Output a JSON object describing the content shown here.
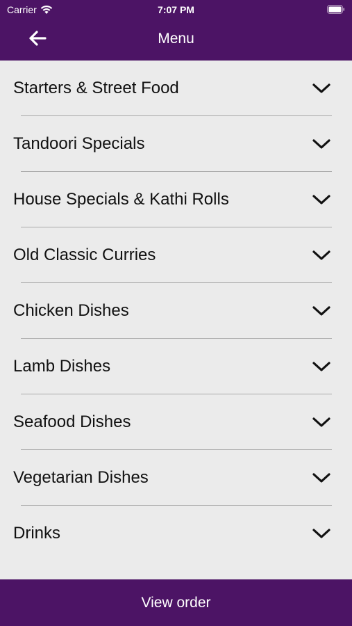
{
  "colors": {
    "brand": "#4c1465",
    "background": "#ebebeb",
    "text": "#111111",
    "divider": "#a9a9a9"
  },
  "status_bar": {
    "carrier": "Carrier",
    "time": "7:07 PM",
    "icons": [
      "wifi-icon",
      "battery-icon"
    ]
  },
  "nav": {
    "title": "Menu",
    "back_icon": "arrow-left-icon"
  },
  "menu": {
    "item_icon": "chevron-down-icon",
    "items": [
      {
        "label": "Starters & Street Food"
      },
      {
        "label": "Tandoori Specials"
      },
      {
        "label": "House Specials & Kathi Rolls"
      },
      {
        "label": "Old Classic Curries"
      },
      {
        "label": "Chicken Dishes"
      },
      {
        "label": "Lamb Dishes"
      },
      {
        "label": "Seafood Dishes"
      },
      {
        "label": "Vegetarian Dishes"
      },
      {
        "label": "Drinks"
      }
    ]
  },
  "footer": {
    "button_label": "View order"
  }
}
